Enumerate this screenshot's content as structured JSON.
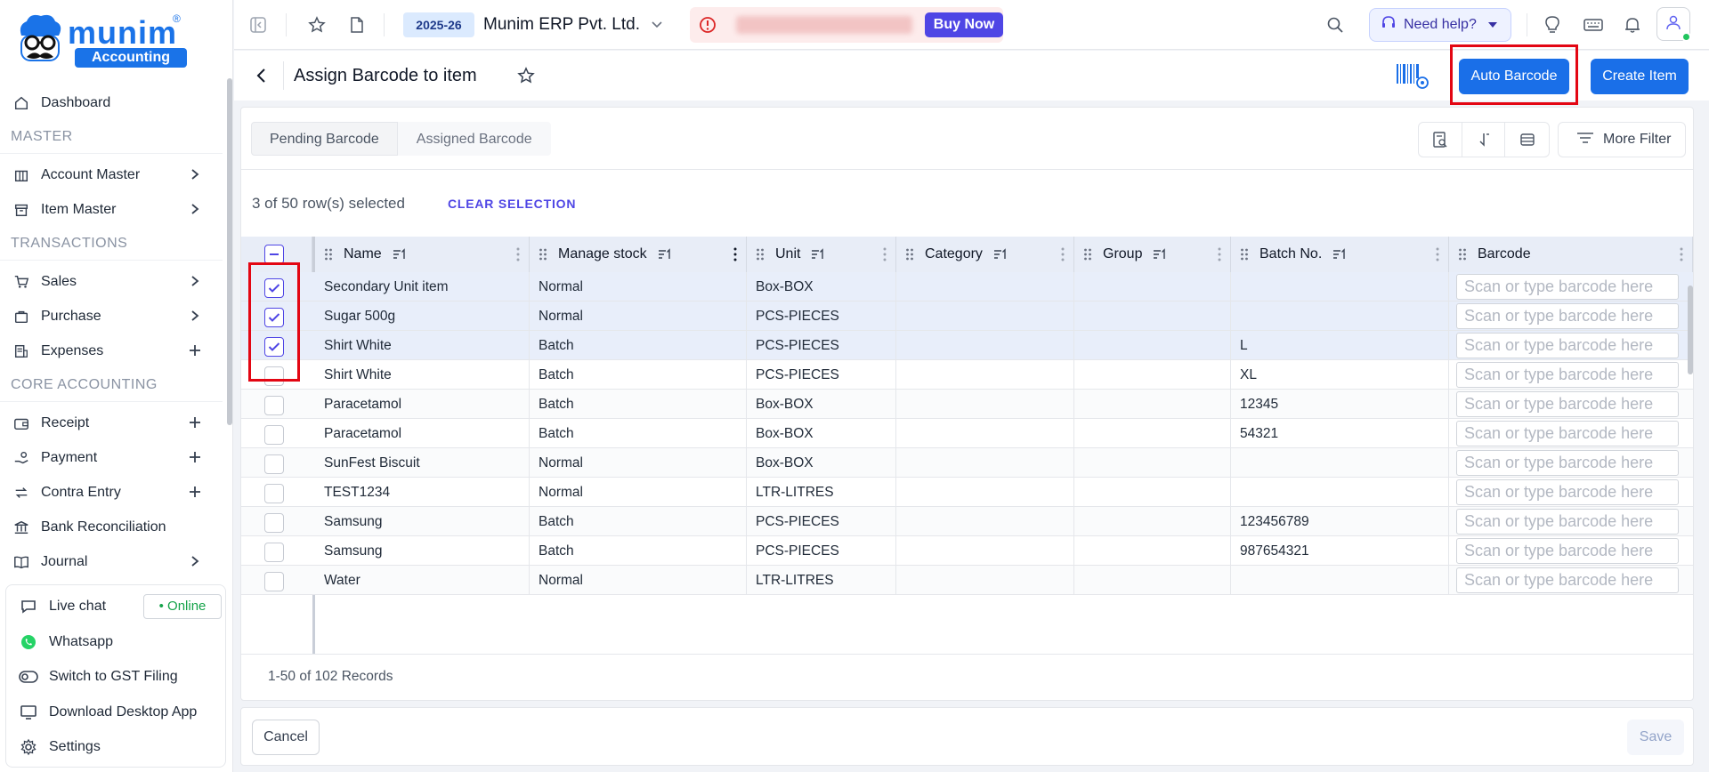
{
  "brand": {
    "name": "munim",
    "reg_mark": "®",
    "tagline": "Accounting"
  },
  "sidebar": {
    "items": [
      {
        "label": "Dashboard"
      },
      {
        "section": "MASTER"
      },
      {
        "label": "Account Master"
      },
      {
        "label": "Item Master"
      },
      {
        "section": "TRANSACTIONS"
      },
      {
        "label": "Sales"
      },
      {
        "label": "Purchase"
      },
      {
        "label": "Expenses"
      },
      {
        "section": "CORE ACCOUNTING"
      },
      {
        "label": "Receipt"
      },
      {
        "label": "Payment"
      },
      {
        "label": "Contra Entry"
      },
      {
        "label": "Bank Reconciliation"
      },
      {
        "label": "Journal"
      }
    ],
    "support": {
      "live_chat": "Live chat",
      "online": "• Online",
      "whatsapp": "Whatsapp",
      "gst": "Switch to GST Filing",
      "desktop": "Download Desktop App",
      "settings": "Settings"
    }
  },
  "topbar": {
    "year": "2025-26",
    "company": "Munim ERP Pvt. Ltd.",
    "buy_now": "Buy Now",
    "need_help": "Need help?"
  },
  "page": {
    "title": "Assign Barcode to item",
    "auto_barcode": "Auto Barcode",
    "create_item": "Create Item"
  },
  "tabs": [
    "Pending Barcode",
    "Assigned Barcode"
  ],
  "toolbar": {
    "more_filter": "More Filter"
  },
  "selection": {
    "info": "3 of 50 row(s) selected",
    "clear": "CLEAR SELECTION"
  },
  "table": {
    "columns": [
      "Name",
      "Manage stock",
      "Unit",
      "Category",
      "Group",
      "Batch No.",
      "Barcode"
    ],
    "barcode_placeholder": "Scan or type barcode here",
    "rows": [
      {
        "checked": true,
        "name": "Secondary Unit item",
        "stock": "Normal",
        "unit": "Box-BOX",
        "category": "",
        "group": "",
        "batch": ""
      },
      {
        "checked": true,
        "name": "Sugar 500g",
        "stock": "Normal",
        "unit": "PCS-PIECES",
        "category": "",
        "group": "",
        "batch": ""
      },
      {
        "checked": true,
        "name": "Shirt White",
        "stock": "Batch",
        "unit": "PCS-PIECES",
        "category": "",
        "group": "",
        "batch": "L"
      },
      {
        "checked": false,
        "name": "Shirt White",
        "stock": "Batch",
        "unit": "PCS-PIECES",
        "category": "",
        "group": "",
        "batch": "XL"
      },
      {
        "checked": false,
        "name": "Paracetamol",
        "stock": "Batch",
        "unit": "Box-BOX",
        "category": "",
        "group": "",
        "batch": "12345"
      },
      {
        "checked": false,
        "name": "Paracetamol",
        "stock": "Batch",
        "unit": "Box-BOX",
        "category": "",
        "group": "",
        "batch": "54321"
      },
      {
        "checked": false,
        "name": "SunFest Biscuit",
        "stock": "Normal",
        "unit": "Box-BOX",
        "category": "",
        "group": "",
        "batch": ""
      },
      {
        "checked": false,
        "name": "TEST1234",
        "stock": "Normal",
        "unit": "LTR-LITRES",
        "category": "",
        "group": "",
        "batch": ""
      },
      {
        "checked": false,
        "name": "Samsung",
        "stock": "Batch",
        "unit": "PCS-PIECES",
        "category": "",
        "group": "",
        "batch": "123456789"
      },
      {
        "checked": false,
        "name": "Samsung",
        "stock": "Batch",
        "unit": "PCS-PIECES",
        "category": "",
        "group": "",
        "batch": "987654321"
      },
      {
        "checked": false,
        "name": "Water",
        "stock": "Normal",
        "unit": "LTR-LITRES",
        "category": "",
        "group": "",
        "batch": ""
      }
    ],
    "records": "1-50 of 102 Records"
  },
  "footer": {
    "cancel": "Cancel",
    "save": "Save"
  },
  "colors": {
    "primary": "#1a6fe8",
    "accent": "#4f46e5",
    "highlight": "#e30613",
    "online": "#16a34a"
  }
}
